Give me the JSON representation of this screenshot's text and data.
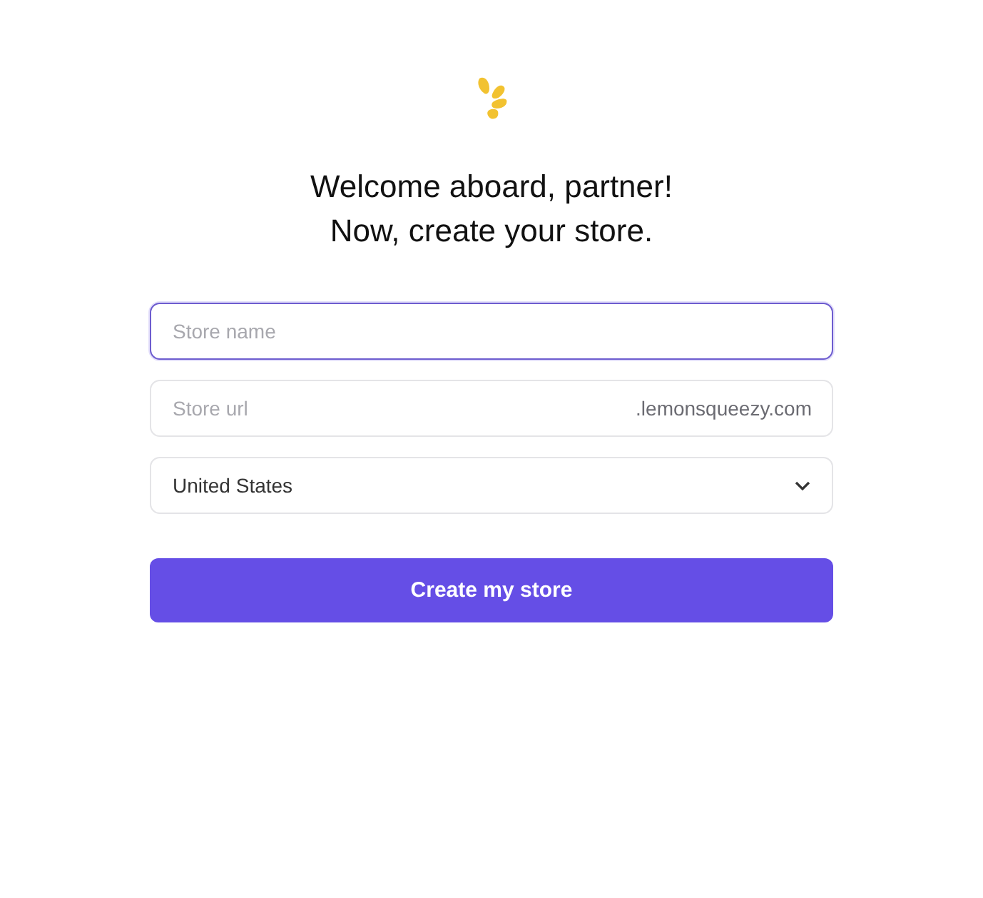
{
  "heading": [
    "Welcome aboard, partner!",
    "Now, create your store."
  ],
  "fields": [
    {
      "kind": "text",
      "placeholder": "Store name",
      "focused": true
    },
    {
      "kind": "url",
      "placeholder": "Store url",
      "suffix": ".lemonsqueezy.com",
      "focused": false
    },
    {
      "kind": "select",
      "value": "United States",
      "focused": false
    }
  ],
  "button": "Create my store"
}
